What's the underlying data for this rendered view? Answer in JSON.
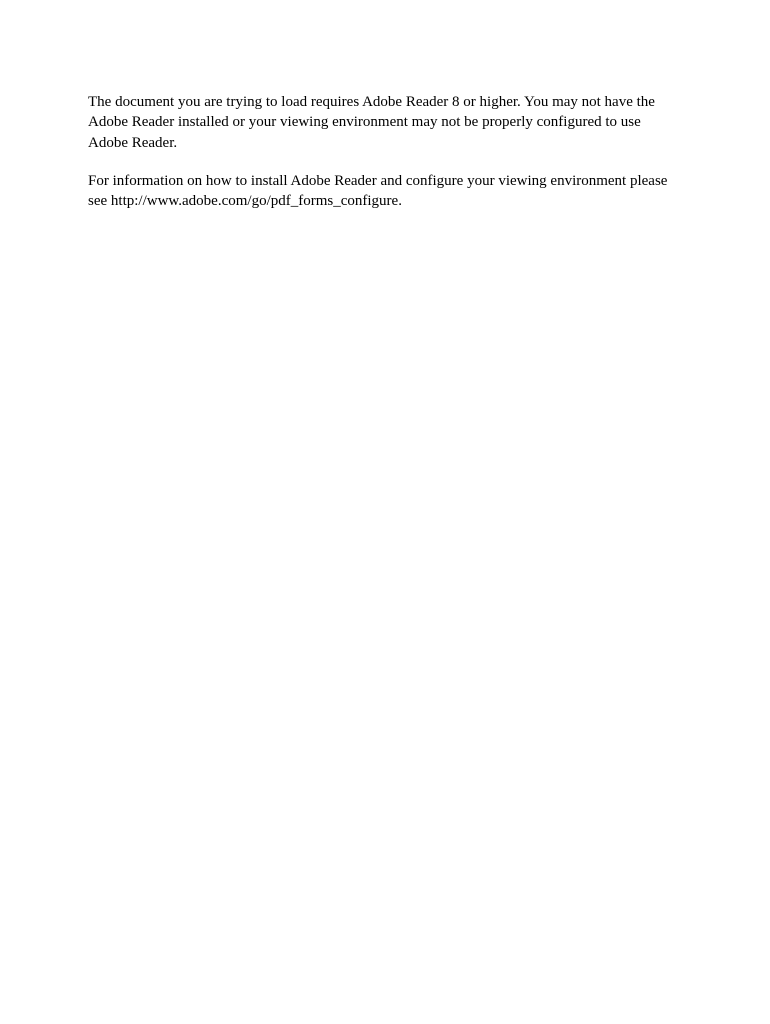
{
  "document": {
    "paragraph1": "The document you are trying to load requires Adobe Reader 8 or higher. You may not have the Adobe Reader installed or your viewing environment may not be properly configured to use Adobe Reader.",
    "paragraph2": "For information on how to install Adobe Reader and configure your viewing environment please see  http://www.adobe.com/go/pdf_forms_configure."
  }
}
